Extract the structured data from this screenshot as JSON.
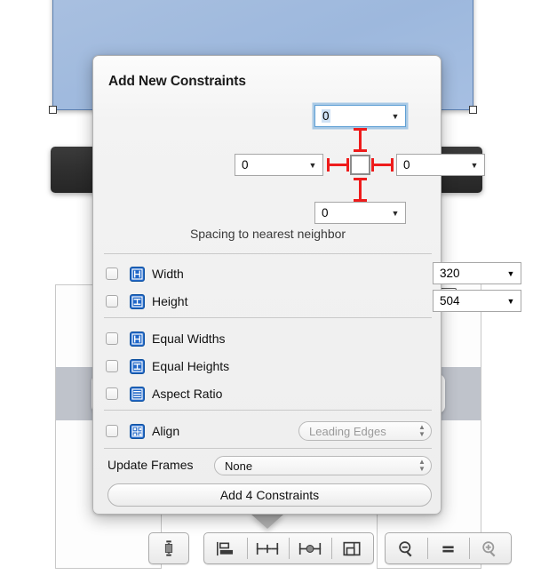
{
  "popover": {
    "title": "Add New Constraints",
    "spacing": {
      "top_value": "0",
      "left_value": "0",
      "right_value": "0",
      "bottom_value": "0",
      "caption": "Spacing to nearest neighbor",
      "top_strut_icon": "constraint-strut-icon",
      "bottom_strut_icon": "constraint-strut-icon",
      "left_strut_icon": "constraint-strut-icon",
      "right_strut_icon": "constraint-strut-icon",
      "center_box_icon": "selected-view-box-icon",
      "dropdown_arrow": "▼"
    },
    "size_rows": [
      {
        "label": "Width",
        "icon": "width-constraint-icon",
        "checked": false,
        "value": "320"
      },
      {
        "label": "Height",
        "icon": "height-constraint-icon",
        "checked": false,
        "value": "504"
      }
    ],
    "equality_rows": [
      {
        "label": "Equal Widths",
        "icon": "equal-widths-icon",
        "checked": false
      },
      {
        "label": "Equal Heights",
        "icon": "equal-heights-icon",
        "checked": false
      },
      {
        "label": "Aspect Ratio",
        "icon": "aspect-ratio-icon",
        "checked": false
      }
    ],
    "align": {
      "label": "Align",
      "icon": "align-constraint-icon",
      "checked": false,
      "value": "Leading Edges",
      "enabled": false,
      "stepper_icon": "stepper-updown-icon"
    },
    "update_frames": {
      "label": "Update Frames",
      "value": "None",
      "stepper_icon": "stepper-updown-icon"
    },
    "add_button": "Add 4 Constraints"
  },
  "toolbar": {
    "groups": [
      {
        "name": "embed-group",
        "buttons": [
          {
            "name": "embed-in-icon",
            "title": "Embed In"
          }
        ]
      },
      {
        "name": "autolayout-group",
        "buttons": [
          {
            "name": "align-icon",
            "title": "Align"
          },
          {
            "name": "pin-icon",
            "title": "Pin"
          },
          {
            "name": "resolve-issues-icon",
            "title": "Resolve Auto Layout Issues"
          },
          {
            "name": "resizing-behavior-icon",
            "title": "Resizing Behavior"
          }
        ]
      },
      {
        "name": "zoom-group",
        "buttons": [
          {
            "name": "zoom-out-icon",
            "title": "Zoom Out"
          },
          {
            "name": "zoom-actual-icon",
            "title": "Actual Size"
          },
          {
            "name": "zoom-in-icon",
            "title": "Zoom In"
          }
        ]
      }
    ]
  },
  "canvas": {
    "selected_view_name": "selected-view",
    "handles": [
      "bottom-left-handle",
      "bottom-right-handle"
    ],
    "dark_bars": [
      "dark-bar-left",
      "dark-bar-right"
    ],
    "status_battery_icon": "battery-icon"
  },
  "colors": {
    "selection_blue": "#a9c0e0",
    "strut_red": "#ee1c1c",
    "constraint_icon_blue": "#1f66c8",
    "focus_ring_blue": "#6aa5d9",
    "text_selection_blue": "#cfe2f5"
  }
}
